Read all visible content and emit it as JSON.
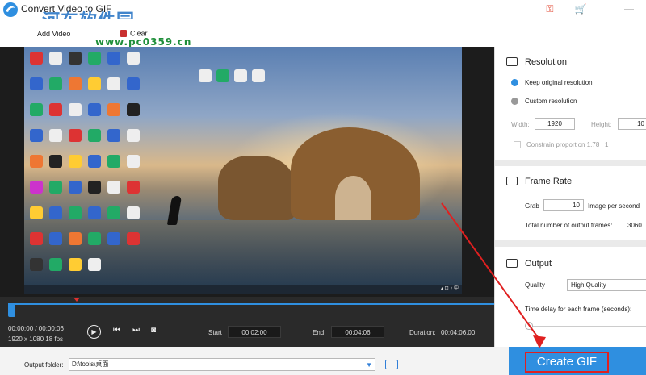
{
  "window": {
    "title": "Convert Video to GIF"
  },
  "watermark": {
    "text": "河东软件园",
    "url_text": "www.pc0359.cn"
  },
  "toolbar": {
    "add_video_label": "Add Video",
    "clear_label": "Clear"
  },
  "player": {
    "current_time": "00:00:00 / 00:00:06",
    "resolution_fps": "1920 x 1080     18 fps",
    "start_label": "Start",
    "start_value": "00:02:00",
    "end_label": "End",
    "end_value": "00:04:06",
    "duration_label": "Duration:",
    "duration_value": "00:04:06.00",
    "progress_fraction": 0.0
  },
  "output": {
    "folder_label": "Output folder:",
    "folder_value": "D:\\tools\\桌面",
    "create_label": "Create GIF"
  },
  "panel": {
    "resolution": {
      "title": "Resolution",
      "keep_label": "Keep original resolution",
      "custom_label": "Custom resolution",
      "width_label": "Width:",
      "width_value": "1920",
      "height_label": "Height:",
      "height_value": "10",
      "constrain_label": "Constrain proportion   1.78 : 1"
    },
    "frame_rate": {
      "title": "Frame Rate",
      "grab_label": "Grab",
      "grab_value": "10",
      "per_second_label": "Image per second",
      "total_label": "Total number of output frames:",
      "total_value": "3060"
    },
    "output": {
      "title": "Output",
      "quality_label": "Quality",
      "quality_value": "High Quality",
      "delay_label": "Time delay for each frame (seconds):"
    }
  },
  "colors": {
    "accent": "#2f8fe0",
    "annotation": "#e02020"
  }
}
